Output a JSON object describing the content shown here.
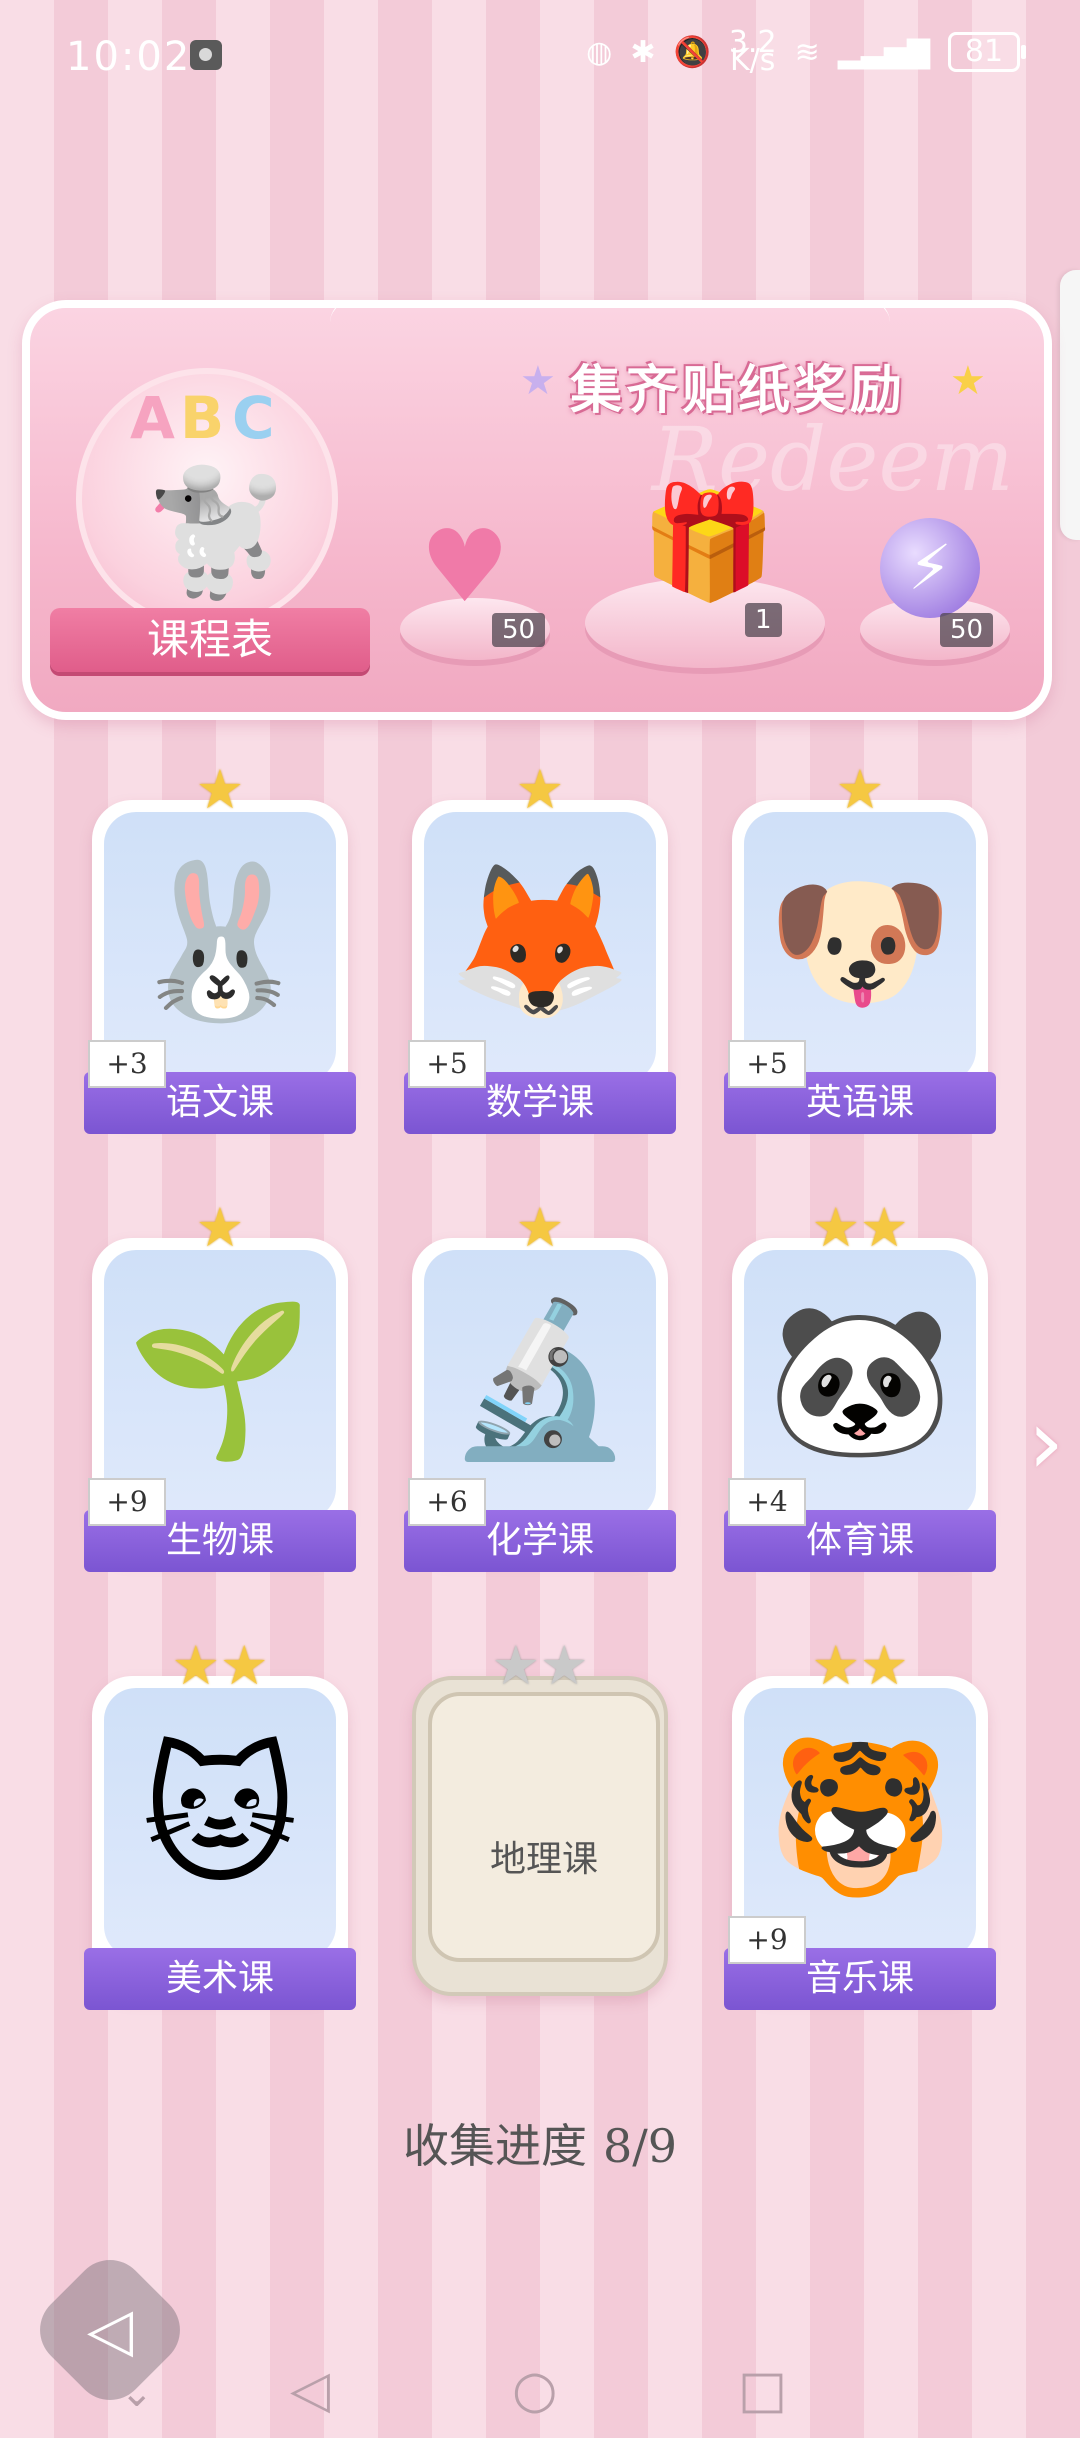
{
  "status_bar": {
    "time": "10:02",
    "speed_top": "3.2",
    "speed_bottom": "K/s",
    "battery": "81"
  },
  "banner": {
    "title": "集齐贴纸奖励",
    "watermark": "Redeem",
    "schedule_label": "课程表",
    "abc": [
      "A",
      "B",
      "C"
    ],
    "rewards": [
      {
        "name": "heart-gem",
        "icon": "pink-heart-gem-icon",
        "count": "50"
      },
      {
        "name": "sticker-box",
        "icon": "gift-box-icon",
        "count": "1"
      },
      {
        "name": "energy-orb",
        "icon": "purple-lightning-orb-icon",
        "count": "50"
      }
    ]
  },
  "courses": [
    {
      "label": "语文课",
      "bonus": "+3",
      "stars": 1,
      "icon": "bunny-calligraphy-icon",
      "emoji": "🐰"
    },
    {
      "label": "数学课",
      "bonus": "+5",
      "stars": 1,
      "icon": "fox-teacher-icon",
      "emoji": "🦊"
    },
    {
      "label": "英语课",
      "bonus": "+5",
      "stars": 1,
      "icon": "poodle-abc-icon",
      "emoji": "🐶"
    },
    {
      "label": "生物课",
      "bonus": "+9",
      "stars": 1,
      "icon": "sun-sprout-icon",
      "emoji": "🌱"
    },
    {
      "label": "化学课",
      "bonus": "+6",
      "stars": 1,
      "icon": "microscope-icon",
      "emoji": "🔬"
    },
    {
      "label": "体育课",
      "bonus": "+4",
      "stars": 2,
      "icon": "panda-pingpong-icon",
      "emoji": "🐼"
    },
    {
      "label": "美术课",
      "bonus": "",
      "stars": 2,
      "icon": "cat-painter-icon",
      "emoji": "🐱"
    },
    {
      "label": "地理课",
      "bonus": "",
      "stars": 2,
      "locked": true,
      "icon": "locked-card-icon",
      "emoji": ""
    },
    {
      "label": "音乐课",
      "bonus": "+9",
      "stars": 2,
      "icon": "cat-keyboard-icon",
      "emoji": "🐯"
    }
  ],
  "progress": {
    "label": "收集进度",
    "value": "8/9"
  },
  "colors": {
    "card_label": "#7b55d2",
    "star": "#f5c842",
    "banner_pink": "#f6b8cd"
  }
}
